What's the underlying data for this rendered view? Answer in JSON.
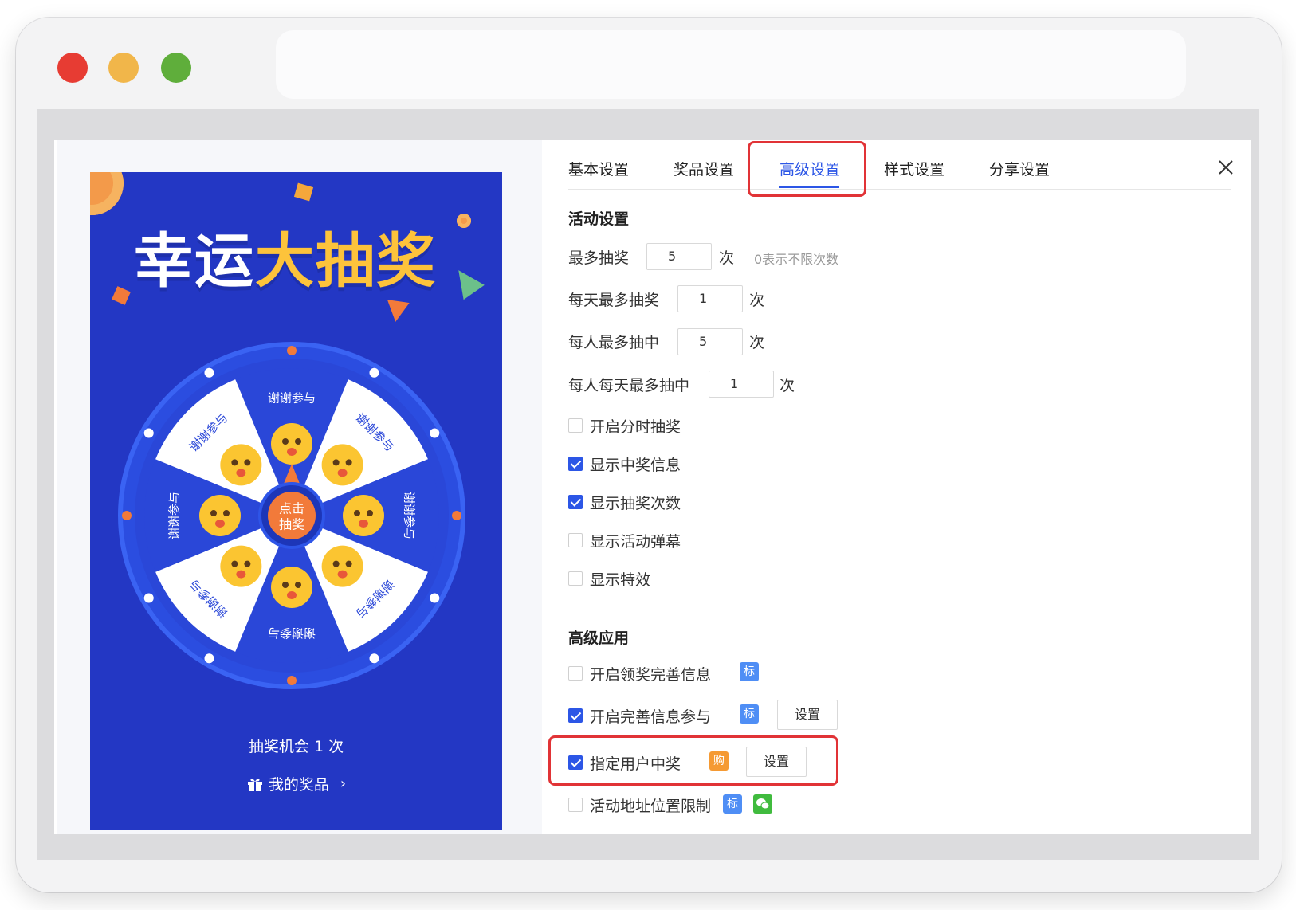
{
  "colors": {
    "accent": "#2c56e6",
    "highlight": "#e13336",
    "phone_bg": "#2337c4",
    "title_yellow": "#fdc33b"
  },
  "preview": {
    "title_white": "幸运",
    "title_yellow": "大抽奖",
    "wheel": {
      "segment_label": "谢谢参与",
      "segment_count": 8,
      "center_line1": "点击",
      "center_line2": "抽奖"
    },
    "chance_text": "抽奖机会 1 次",
    "my_prize": "我的奖品",
    "my_prize_icon": "gift-icon"
  },
  "tabs": [
    {
      "label": "基本设置",
      "active": false
    },
    {
      "label": "奖品设置",
      "active": false
    },
    {
      "label": "高级设置",
      "active": true
    },
    {
      "label": "样式设置",
      "active": false
    },
    {
      "label": "分享设置",
      "active": false
    }
  ],
  "activity": {
    "heading": "活动设置",
    "fields": [
      {
        "label": "最多抽奖",
        "value": "5",
        "unit": "次",
        "hint": "0表示不限次数"
      },
      {
        "label": "每天最多抽奖",
        "value": "1",
        "unit": "次"
      },
      {
        "label": "每人最多抽中",
        "value": "5",
        "unit": "次"
      },
      {
        "label": "每人每天最多抽中",
        "value": "1",
        "unit": "次"
      }
    ],
    "options": [
      {
        "label": "开启分时抽奖",
        "checked": false
      },
      {
        "label": "显示中奖信息",
        "checked": true
      },
      {
        "label": "显示抽奖次数",
        "checked": true
      },
      {
        "label": "显示活动弹幕",
        "checked": false
      },
      {
        "label": "显示特效",
        "checked": false
      }
    ]
  },
  "advanced": {
    "heading": "高级应用",
    "items": [
      {
        "label": "开启领奖完善信息",
        "checked": false,
        "badge": "标"
      },
      {
        "label": "开启完善信息参与",
        "checked": true,
        "badge": "标",
        "button": "设置"
      },
      {
        "label": "指定用户中奖",
        "checked": true,
        "badge": "购",
        "button": "设置"
      },
      {
        "label": "活动地址位置限制",
        "checked": false,
        "badge": "标",
        "badge2_icon": "wechat-icon"
      }
    ]
  }
}
